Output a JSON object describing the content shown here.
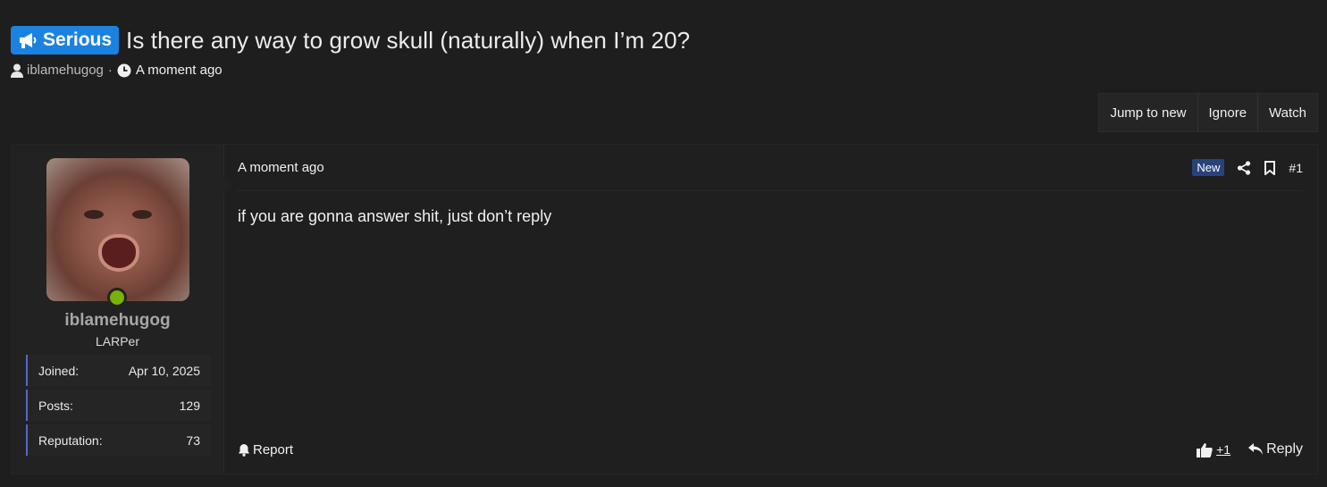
{
  "thread": {
    "prefix": "Serious",
    "title": "Is there any way to grow skull (naturally) when I’m 20?",
    "author": "iblamehugog",
    "separator": "·",
    "time": "A moment ago"
  },
  "actions": {
    "jump_to_new": "Jump to new",
    "ignore": "Ignore",
    "watch": "Watch"
  },
  "post": {
    "user": {
      "username": "iblamehugog",
      "title": "LARPer",
      "stats": [
        {
          "label": "Joined:",
          "value": "Apr 10, 2025"
        },
        {
          "label": "Posts:",
          "value": "129"
        },
        {
          "label": "Reputation:",
          "value": "73"
        }
      ]
    },
    "date": "A moment ago",
    "new_badge": "New",
    "number": "#1",
    "body": "if you are gonna answer shit, just don’t reply",
    "report_label": "Report",
    "reaction_count": "+1",
    "reply_label": "Reply"
  },
  "colors": {
    "background": "#1e1e1e",
    "prefix_badge": "#1c82e0",
    "new_badge": "#29427a",
    "online": "#77b300",
    "stat_border": "#5566cc"
  }
}
